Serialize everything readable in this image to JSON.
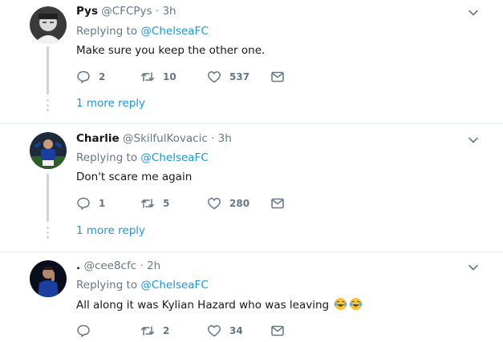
{
  "tweets": [
    {
      "name": "Pys",
      "handle": "@CFCPys",
      "time": "3h",
      "replying_label": "Replying to",
      "replying_to": "@ChelseaFC",
      "text": "Make sure you keep the other one.",
      "replies": "2",
      "retweets": "10",
      "likes": "537",
      "more_reply": "1 more reply"
    },
    {
      "name": "Charlie",
      "handle": "@SkilfulKovacic",
      "time": "3h",
      "replying_label": "Replying to",
      "replying_to": "@ChelseaFC",
      "text": "Don't scare me again",
      "replies": "1",
      "retweets": "5",
      "likes": "280",
      "more_reply": "1 more reply"
    },
    {
      "name": ".",
      "handle": "@cee8cfc",
      "time": "2h",
      "replying_label": "Replying to",
      "replying_to": "@ChelseaFC",
      "text": "All along it was Kylian Hazard who was leaving",
      "text_emoji": "face-with-tears-of-joy x2",
      "replies": "",
      "retweets": "2",
      "likes": "34",
      "more_reply": ""
    }
  ],
  "separator": "·",
  "icons": {
    "reply": "reply-icon",
    "retweet": "retweet-icon",
    "like": "heart-icon",
    "dm": "envelope-icon",
    "menu": "chevron-down-icon"
  },
  "colors": {
    "link": "#1b95e0",
    "muted": "#657786",
    "text": "#14171a",
    "divider": "#e6ecf0"
  }
}
